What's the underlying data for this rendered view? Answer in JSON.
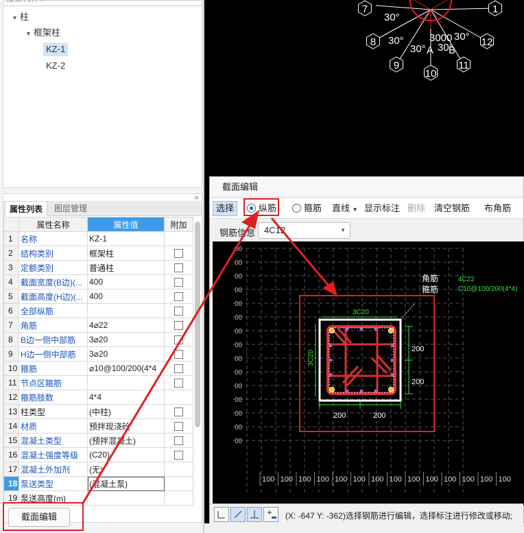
{
  "tree": {
    "search_placeholder": "搜索构件...",
    "nodes": [
      {
        "label": "柱",
        "level": 0
      },
      {
        "label": "框架柱",
        "level": 1
      },
      {
        "label": "KZ-1",
        "level": 2,
        "selected": true
      },
      {
        "label": "KZ-2",
        "level": 2
      }
    ]
  },
  "props": {
    "tabs": [
      "属性列表",
      "图层管理"
    ],
    "close": "×",
    "headers": [
      "属性名称",
      "属性值",
      "附加"
    ],
    "rows": [
      {
        "n": "1",
        "name": "名称",
        "value": "KZ-1",
        "check": false
      },
      {
        "n": "2",
        "name": "结构类别",
        "value": "框架柱",
        "check": true
      },
      {
        "n": "3",
        "name": "定额类别",
        "value": "普通柱",
        "check": true
      },
      {
        "n": "4",
        "name": "截面宽度(B边)(...",
        "value": "400",
        "check": true
      },
      {
        "n": "5",
        "name": "截面高度(H边)(...",
        "value": "400",
        "check": true
      },
      {
        "n": "6",
        "name": "全部纵筋",
        "value": "",
        "check": true
      },
      {
        "n": "7",
        "name": "角筋",
        "value": "4⌀22",
        "check": true
      },
      {
        "n": "8",
        "name": "B边一侧中部筋",
        "value": "3⌀20",
        "check": true
      },
      {
        "n": "9",
        "name": "H边一侧中部筋",
        "value": "3⌀20",
        "check": true
      },
      {
        "n": "10",
        "name": "箍筋",
        "value": "⌀10@100/200(4*4",
        "check": true
      },
      {
        "n": "11",
        "name": "节点区箍筋",
        "value": "",
        "check": true
      },
      {
        "n": "12",
        "name": "箍筋肢数",
        "value": "4*4",
        "check": false
      },
      {
        "n": "13",
        "name": "柱类型",
        "value": "(中柱)",
        "check": true,
        "black": true
      },
      {
        "n": "14",
        "name": "材质",
        "value": "预拌现浇砼",
        "check": true
      },
      {
        "n": "15",
        "name": "混凝土类型",
        "value": "(预拌混凝土)",
        "check": true
      },
      {
        "n": "16",
        "name": "混凝土强度等级",
        "value": "(C20)",
        "check": true
      },
      {
        "n": "17",
        "name": "混凝土外加剂",
        "value": "(无)",
        "check": false
      },
      {
        "n": "18",
        "name": "泵送类型",
        "value": "(混凝土泵)",
        "check": false,
        "selected": true
      },
      {
        "n": "19",
        "name": "泵送高度(m)",
        "value": "",
        "check": false,
        "black": true
      }
    ]
  },
  "section_button": "截面编辑",
  "dialog": {
    "title": "截面编辑",
    "toolbar": {
      "select": "选择",
      "longitudinal": "纵筋",
      "stirrup": "箍筋",
      "line": "直线",
      "show_dim": "显示标注",
      "delete": "删除",
      "clear": "清空钢筋",
      "corner": "布角筋"
    },
    "rebar_label": "钢筋信息",
    "rebar_value": "4C12",
    "status_text": "(X: -647 Y: -362)选择钢筋进行编辑，选择标注进行修改或移动;"
  },
  "drawing": {
    "grid_left_labels": [
      "00",
      "00",
      "00",
      "00",
      "00",
      "00",
      "00",
      "00",
      "00",
      "00",
      "00",
      "00",
      "00",
      "00",
      "00"
    ],
    "grid_bottom_labels": [
      "100",
      "100",
      "100",
      "100",
      "100",
      "100",
      "100",
      "100",
      "100",
      "100",
      "100",
      "100",
      "100",
      "100"
    ],
    "label_corner": "角筋",
    "label_stirrup": "箍筋",
    "spec_corner": "4C22",
    "spec_stirrup": "C10@100/200(4*4)",
    "top_dim": "3C20",
    "left_dim": "3C20",
    "dim_right": [
      "200",
      "200"
    ],
    "dim_bottom": [
      "200",
      "200"
    ]
  },
  "viewport_top": {
    "nodes": [
      "7",
      "1",
      "8",
      "12",
      "9",
      "11",
      "10"
    ],
    "angles": [
      "30°",
      "30°",
      "30°",
      "30°",
      "30°"
    ],
    "value": "3000",
    "letters": [
      "A",
      "B"
    ]
  },
  "colors": {
    "red": "#e02020",
    "green": "#39e639",
    "accent": "#3e9bea"
  }
}
